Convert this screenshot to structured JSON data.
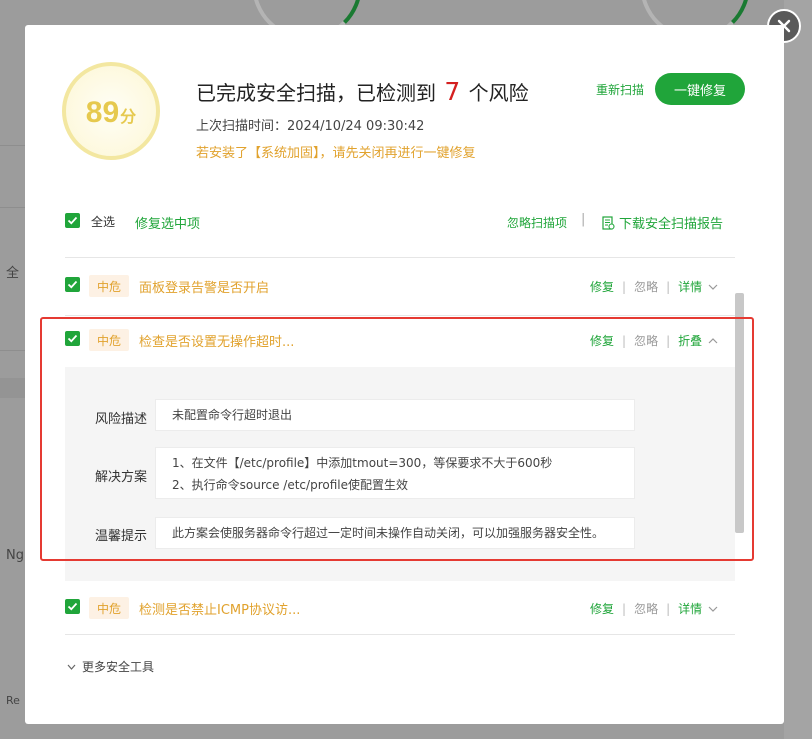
{
  "background": {
    "texts": [
      "全",
      "Ng",
      "Re"
    ]
  },
  "dialog": {
    "score": {
      "value": "89",
      "unit": "分"
    },
    "title_prefix": "已完成安全扫描，已检测到",
    "risk_count": "7",
    "title_suffix": "个风险",
    "scan_time": "上次扫描时间：2024/10/24 09:30:42",
    "warning": "若安装了【系统加固】，请先关闭再进行一键修复",
    "rescan_label": "重新扫描",
    "fix_all_label": "一键修复",
    "toolbar": {
      "select_all_label": "全选",
      "fix_selected_label": "修复选中项",
      "ignore_items_label": "忽略扫描项",
      "separator": "|",
      "download_report_label": "下载安全扫描报告"
    },
    "risk_items": [
      {
        "level": "中危",
        "title": "面板登录告警是否开启",
        "fix": "修复",
        "ignore": "忽略",
        "toggle": "详情"
      },
      {
        "level": "中危",
        "title": "检查是否设置无操作超时...",
        "fix": "修复",
        "ignore": "忽略",
        "toggle": "折叠",
        "details": {
          "risk_desc_label": "风险描述",
          "risk_desc": "未配置命令行超时退出",
          "solution_label": "解决方案",
          "solution_lines": [
            "1、在文件【/etc/profile】中添加tmout=300，等保要求不大于600秒",
            "2、执行命令source /etc/profile使配置生效"
          ],
          "tip_label": "温馨提示",
          "tip": "此方案会使服务器命令行超过一定时间未操作自动关闭，可以加强服务器安全性。"
        }
      },
      {
        "level": "中危",
        "title": "检测是否禁止ICMP协议访...",
        "fix": "修复",
        "ignore": "忽略",
        "toggle": "详情"
      }
    ],
    "action_separator": "|",
    "more_tools_label": "更多安全工具"
  },
  "colors": {
    "accent": "#20a53a",
    "warning": "#e1a22d",
    "risk_count": "#d42020",
    "highlight": "#e53a32",
    "score": "#e6c94e"
  }
}
